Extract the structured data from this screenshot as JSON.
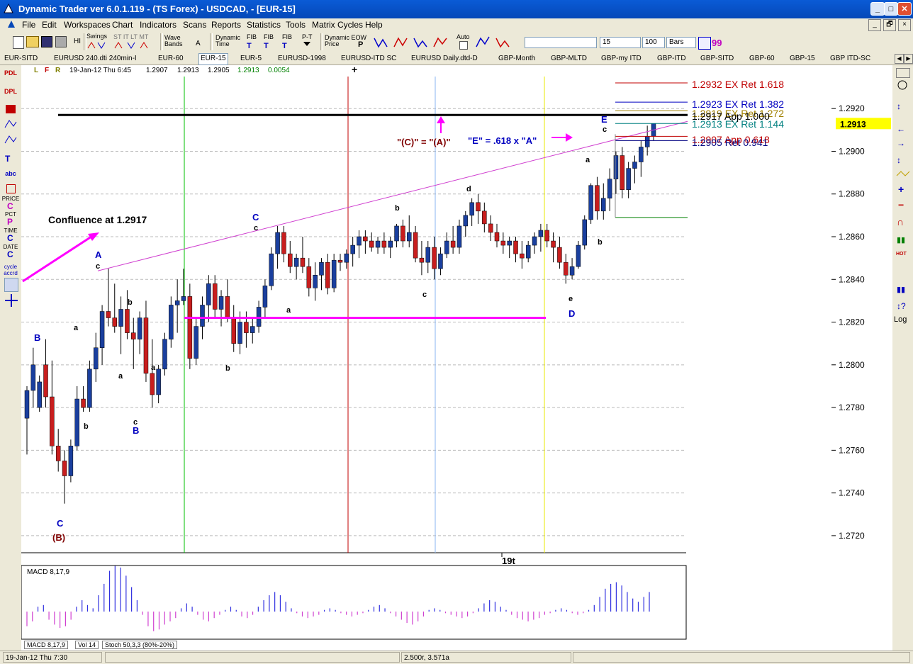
{
  "window": {
    "title": "Dynamic Trader ver 6.0.1.119 - (TS Forex) - USDCAD, - [EUR-15]",
    "controls": {
      "minimize": "_",
      "maximize": "□",
      "close": "✕"
    }
  },
  "menu": {
    "items": [
      "File",
      "Edit",
      "Workspaces",
      "Chart",
      "Indicators",
      "Scans",
      "Reports",
      "Statistics",
      "Tools",
      "Matrix Cycles",
      "Help"
    ],
    "mdi_controls": {
      "minimize": "_",
      "restore": "🗗",
      "close": "×"
    }
  },
  "toolbar": {
    "hi_label": "HI",
    "swings_label": "Swings",
    "swings_sub": "ST IT LT MT",
    "wave_bands_label": "Wave Bands",
    "wave_a_label": "A",
    "dynamic_time_label": "Dynamic Time",
    "fib_label": "FIB",
    "pt_label": "P-T",
    "dynamic_eow_label": "Dynamic EOW Price",
    "eow_p_label": "P",
    "auto_label": "Auto",
    "interval_value": "15",
    "bars_count_value": "100",
    "bars_unit_value": "Bars"
  },
  "tabs": [
    "EUR-SITD",
    "EURUSD  240.dti 240min-I",
    "EUR-60",
    "EUR-15",
    "EUR-5",
    "EURUSD-1998",
    "EURUSD-ITD SC",
    "EURUSD  Daily.dtd-D",
    "GBP-Month",
    "GBP-MLTD",
    "GBP-my ITD",
    "GBP-ITD",
    "GBP-SITD",
    "GBP-60",
    "GBP-15",
    "GBP ITD-SC"
  ],
  "active_tab": "EUR-15",
  "left_toolbar": [
    "PDL",
    "DPL",
    "PRICE",
    "PCT",
    "TIME",
    "DATE",
    "cycle accrd",
    "abc"
  ],
  "chart_header": {
    "flags": [
      "L",
      "F",
      "R"
    ],
    "bar_info": "19-Jan-12 Thu 6:45",
    "open": "1.2907",
    "high": "1.2913",
    "low": "1.2905",
    "close": "1.2913",
    "change": "0.0054"
  },
  "chart_data": {
    "type": "candlestick",
    "symbol": "USDCAD",
    "interval": "15",
    "y_ticks": [
      "1.2920",
      "1.2900",
      "1.2880",
      "1.2860",
      "1.2840",
      "1.2820",
      "1.2800",
      "1.2780",
      "1.2760",
      "1.2740",
      "1.2720"
    ],
    "ylim": [
      1.2712,
      1.2935
    ],
    "last_price": "1.2913",
    "x_label": "19t",
    "candles": [
      [
        1.2775,
        1.279,
        1.2758,
        1.2788
      ],
      [
        1.2788,
        1.2808,
        1.278,
        1.28
      ],
      [
        1.278,
        1.2795,
        1.2778,
        1.2792
      ],
      [
        1.28,
        1.2812,
        1.278,
        1.2785
      ],
      [
        1.2785,
        1.2802,
        1.2758,
        1.2762
      ],
      [
        1.2762,
        1.277,
        1.275,
        1.2755
      ],
      [
        1.2755,
        1.276,
        1.2735,
        1.2748
      ],
      [
        1.2748,
        1.2765,
        1.2745,
        1.2762
      ],
      [
        1.2762,
        1.279,
        1.276,
        1.2784
      ],
      [
        1.2784,
        1.279,
        1.2778,
        1.278
      ],
      [
        1.278,
        1.2802,
        1.2778,
        1.2798
      ],
      [
        1.2798,
        1.2815,
        1.2792,
        1.2808
      ],
      [
        1.2808,
        1.2828,
        1.28,
        1.2825
      ],
      [
        1.2825,
        1.2845,
        1.2818,
        1.2822
      ],
      [
        1.2822,
        1.2838,
        1.2815,
        1.2818
      ],
      [
        1.2818,
        1.2832,
        1.2805,
        1.2826
      ],
      [
        1.2826,
        1.2835,
        1.2812,
        1.2815
      ],
      [
        1.2815,
        1.2822,
        1.2798,
        1.2812
      ],
      [
        1.2812,
        1.2825,
        1.2805,
        1.2822
      ],
      [
        1.2822,
        1.283,
        1.2792,
        1.2796
      ],
      [
        1.2796,
        1.2812,
        1.278,
        1.2786
      ],
      [
        1.2786,
        1.28,
        1.2782,
        1.2798
      ],
      [
        1.2798,
        1.2815,
        1.2795,
        1.2812
      ],
      [
        1.2812,
        1.2832,
        1.2808,
        1.2828
      ],
      [
        1.2828,
        1.284,
        1.2815,
        1.283
      ],
      [
        1.283,
        1.2845,
        1.2828,
        1.2832
      ],
      [
        1.2832,
        1.2838,
        1.2798,
        1.2803
      ],
      [
        1.2803,
        1.2822,
        1.28,
        1.2818
      ],
      [
        1.2818,
        1.2832,
        1.2812,
        1.2828
      ],
      [
        1.2828,
        1.2842,
        1.282,
        1.2838
      ],
      [
        1.2838,
        1.2842,
        1.2822,
        1.2826
      ],
      [
        1.2826,
        1.2835,
        1.2818,
        1.2832
      ],
      [
        1.2832,
        1.284,
        1.282,
        1.2822
      ],
      [
        1.2822,
        1.2828,
        1.2806,
        1.281
      ],
      [
        1.281,
        1.2825,
        1.2805,
        1.282
      ],
      [
        1.282,
        1.2825,
        1.2808,
        1.2815
      ],
      [
        1.2815,
        1.2822,
        1.281,
        1.2818
      ],
      [
        1.2818,
        1.283,
        1.2815,
        1.2827
      ],
      [
        1.2827,
        1.284,
        1.2822,
        1.2837
      ],
      [
        1.2837,
        1.2855,
        1.2835,
        1.2852
      ],
      [
        1.2852,
        1.2865,
        1.2845,
        1.2862
      ],
      [
        1.2862,
        1.2865,
        1.2848,
        1.2852
      ],
      [
        1.2852,
        1.2858,
        1.2843,
        1.2846
      ],
      [
        1.2846,
        1.2852,
        1.284,
        1.285
      ],
      [
        1.285,
        1.286,
        1.2843,
        1.2846
      ],
      [
        1.2846,
        1.285,
        1.2832,
        1.2836
      ],
      [
        1.2836,
        1.2848,
        1.283,
        1.2842
      ],
      [
        1.2842,
        1.285,
        1.2835,
        1.2848
      ],
      [
        1.2848,
        1.2852,
        1.2833,
        1.2836
      ],
      [
        1.2836,
        1.2852,
        1.2834,
        1.2849
      ],
      [
        1.2849,
        1.2852,
        1.2844,
        1.2848
      ],
      [
        1.2848,
        1.2854,
        1.2845,
        1.2852
      ],
      [
        1.2852,
        1.286,
        1.2846,
        1.2856
      ],
      [
        1.2856,
        1.2863,
        1.285,
        1.286
      ],
      [
        1.286,
        1.2863,
        1.2852,
        1.2858
      ],
      [
        1.2858,
        1.2862,
        1.2853,
        1.2855
      ],
      [
        1.2855,
        1.286,
        1.2852,
        1.2858
      ],
      [
        1.2858,
        1.2862,
        1.2852,
        1.2855
      ],
      [
        1.2855,
        1.286,
        1.285,
        1.2858
      ],
      [
        1.2858,
        1.2866,
        1.2855,
        1.2865
      ],
      [
        1.2865,
        1.2868,
        1.2855,
        1.2858
      ],
      [
        1.2858,
        1.287,
        1.2855,
        1.2862
      ],
      [
        1.2862,
        1.2865,
        1.2848,
        1.285
      ],
      [
        1.285,
        1.2858,
        1.2842,
        1.2848
      ],
      [
        1.2848,
        1.2858,
        1.2843,
        1.2855
      ],
      [
        1.2855,
        1.286,
        1.284,
        1.2845
      ],
      [
        1.2845,
        1.2855,
        1.2842,
        1.2852
      ],
      [
        1.2852,
        1.2862,
        1.285,
        1.2858
      ],
      [
        1.2858,
        1.2865,
        1.2852,
        1.2855
      ],
      [
        1.2855,
        1.2868,
        1.2852,
        1.2865
      ],
      [
        1.2865,
        1.2872,
        1.286,
        1.287
      ],
      [
        1.287,
        1.2878,
        1.2865,
        1.2876
      ],
      [
        1.2876,
        1.288,
        1.2866,
        1.2872
      ],
      [
        1.2872,
        1.2876,
        1.2862,
        1.2866
      ],
      [
        1.2866,
        1.287,
        1.2858,
        1.2862
      ],
      [
        1.2862,
        1.2866,
        1.2855,
        1.2858
      ],
      [
        1.2858,
        1.2862,
        1.2852,
        1.2856
      ],
      [
        1.2856,
        1.286,
        1.285,
        1.2858
      ],
      [
        1.2858,
        1.286,
        1.2848,
        1.2852
      ],
      [
        1.2852,
        1.2858,
        1.2845,
        1.285
      ],
      [
        1.285,
        1.2858,
        1.2848,
        1.2856
      ],
      [
        1.2856,
        1.2862,
        1.2852,
        1.286
      ],
      [
        1.286,
        1.2866,
        1.2853,
        1.2863
      ],
      [
        1.2863,
        1.2866,
        1.2855,
        1.2858
      ],
      [
        1.2858,
        1.2862,
        1.2848,
        1.2855
      ],
      [
        1.2855,
        1.286,
        1.2845,
        1.2848
      ],
      [
        1.2848,
        1.2852,
        1.2838,
        1.2842
      ],
      [
        1.2842,
        1.285,
        1.284,
        1.2846
      ],
      [
        1.2846,
        1.2858,
        1.2845,
        1.2856
      ],
      [
        1.2856,
        1.287,
        1.2854,
        1.2868
      ],
      [
        1.2868,
        1.2885,
        1.2866,
        1.2884
      ],
      [
        1.2884,
        1.2888,
        1.2868,
        1.2872
      ],
      [
        1.2872,
        1.2885,
        1.2868,
        1.2878
      ],
      [
        1.2878,
        1.2892,
        1.2872,
        1.2887
      ],
      [
        1.2887,
        1.29,
        1.288,
        1.2898
      ],
      [
        1.2898,
        1.2902,
        1.2878,
        1.2882
      ],
      [
        1.2882,
        1.2895,
        1.2878,
        1.2892
      ],
      [
        1.2892,
        1.2898,
        1.2885,
        1.2895
      ],
      [
        1.2895,
        1.2905,
        1.2888,
        1.2902
      ],
      [
        1.2902,
        1.2912,
        1.2898,
        1.2907
      ],
      [
        1.2907,
        1.2913,
        1.2905,
        1.2913
      ]
    ],
    "vertical_line_colors": [
      "#00c000",
      "#c00000",
      "#8ab4f0",
      "#e8e800"
    ],
    "horizontal_levels": [
      {
        "price": 1.2917,
        "color": "#000000",
        "label": "Confluence at 1.2917"
      },
      {
        "price": 1.2822,
        "color": "#ff00ff",
        "label": ""
      }
    ],
    "projection_levels": [
      {
        "label": "1.2932 EX Ret 1.618",
        "color": "#c00000"
      },
      {
        "label": "1.2923 EX Ret 1.382",
        "color": "#0000c0"
      },
      {
        "label": "1.2919 EX Ret 1.272",
        "color": "#a08000"
      },
      {
        "label": "1.2917 App 1.000",
        "color": "#000000"
      },
      {
        "label": "1.2913 EX Ret 1.144",
        "color": "#008080"
      },
      {
        "label": "1.2907 App 0.618",
        "color": "#c00000"
      },
      {
        "label": "1.2905 Ret 0.941",
        "color": "#000080"
      }
    ],
    "wave_labels": [
      {
        "text": "(B)",
        "color": "#800000"
      },
      {
        "text": "C",
        "color": "#0000c0"
      },
      {
        "text": "B",
        "color": "#0000c0"
      },
      {
        "text": "A",
        "color": "#0000c0"
      },
      {
        "text": "c",
        "color": "#000"
      },
      {
        "text": "a",
        "color": "#000"
      },
      {
        "text": "b",
        "color": "#000"
      },
      {
        "text": "b",
        "color": "#000"
      },
      {
        "text": "a",
        "color": "#000"
      },
      {
        "text": "c",
        "color": "#000"
      },
      {
        "text": "B",
        "color": "#0000c0"
      },
      {
        "text": "a",
        "color": "#000"
      },
      {
        "text": "b",
        "color": "#000"
      },
      {
        "text": "C",
        "color": "#0000c0"
      },
      {
        "text": "c",
        "color": "#000"
      },
      {
        "text": "a",
        "color": "#000"
      },
      {
        "text": "b",
        "color": "#000"
      },
      {
        "text": "c",
        "color": "#000"
      },
      {
        "text": "d",
        "color": "#000"
      },
      {
        "text": "e",
        "color": "#000"
      },
      {
        "text": "D",
        "color": "#0000c0"
      },
      {
        "text": "a",
        "color": "#000"
      },
      {
        "text": "b",
        "color": "#000"
      },
      {
        "text": "c",
        "color": "#000"
      },
      {
        "text": "E",
        "color": "#0000c0"
      }
    ],
    "annotations": {
      "confluence": "Confluence at 1.2917",
      "c_equals_a": "\"(C)\" = \"(A)\"",
      "e_ratio": "\"E\" = .618 x \"A\""
    },
    "macd": {
      "label": "MACD 8,17,9",
      "values": [
        -9,
        -6,
        3,
        4,
        -5,
        -8,
        -10,
        -9,
        -5,
        3,
        7,
        4,
        2,
        10,
        17,
        25,
        28,
        27,
        22,
        15,
        7,
        -2,
        -9,
        -12,
        -11,
        -8,
        -6,
        -4,
        2,
        5,
        3,
        -2,
        -5,
        -6,
        -4,
        -2,
        1,
        3,
        1,
        -3,
        -4,
        -2,
        3,
        7,
        10,
        12,
        10,
        6,
        2,
        -1,
        -3,
        -4,
        -3,
        -2,
        1,
        2,
        1,
        -1,
        -2,
        -3,
        -2,
        -1,
        1,
        3,
        4,
        2,
        -1,
        -3,
        -5,
        -7,
        -8,
        -6,
        -3,
        1,
        2,
        1,
        -1,
        -2,
        -3,
        -4,
        -3,
        -1,
        2,
        5,
        7,
        6,
        3,
        1,
        -2,
        -4,
        -5,
        -6,
        -5,
        -4,
        -2,
        -1,
        1,
        2,
        1,
        -1,
        -2,
        -1,
        1,
        4,
        9,
        14,
        17,
        18,
        16,
        12,
        8,
        6,
        9,
        12
      ]
    }
  },
  "bottom_tabs": [
    "MACD 8,17,9",
    "Vol 14",
    "Stoch 50,3,3 (80%-20%)"
  ],
  "status": {
    "datetime": "19-Jan-12 Thu 7:30",
    "scale": "2.500r, 3.571a"
  },
  "right_toolbar": {
    "log_label": "Log"
  }
}
